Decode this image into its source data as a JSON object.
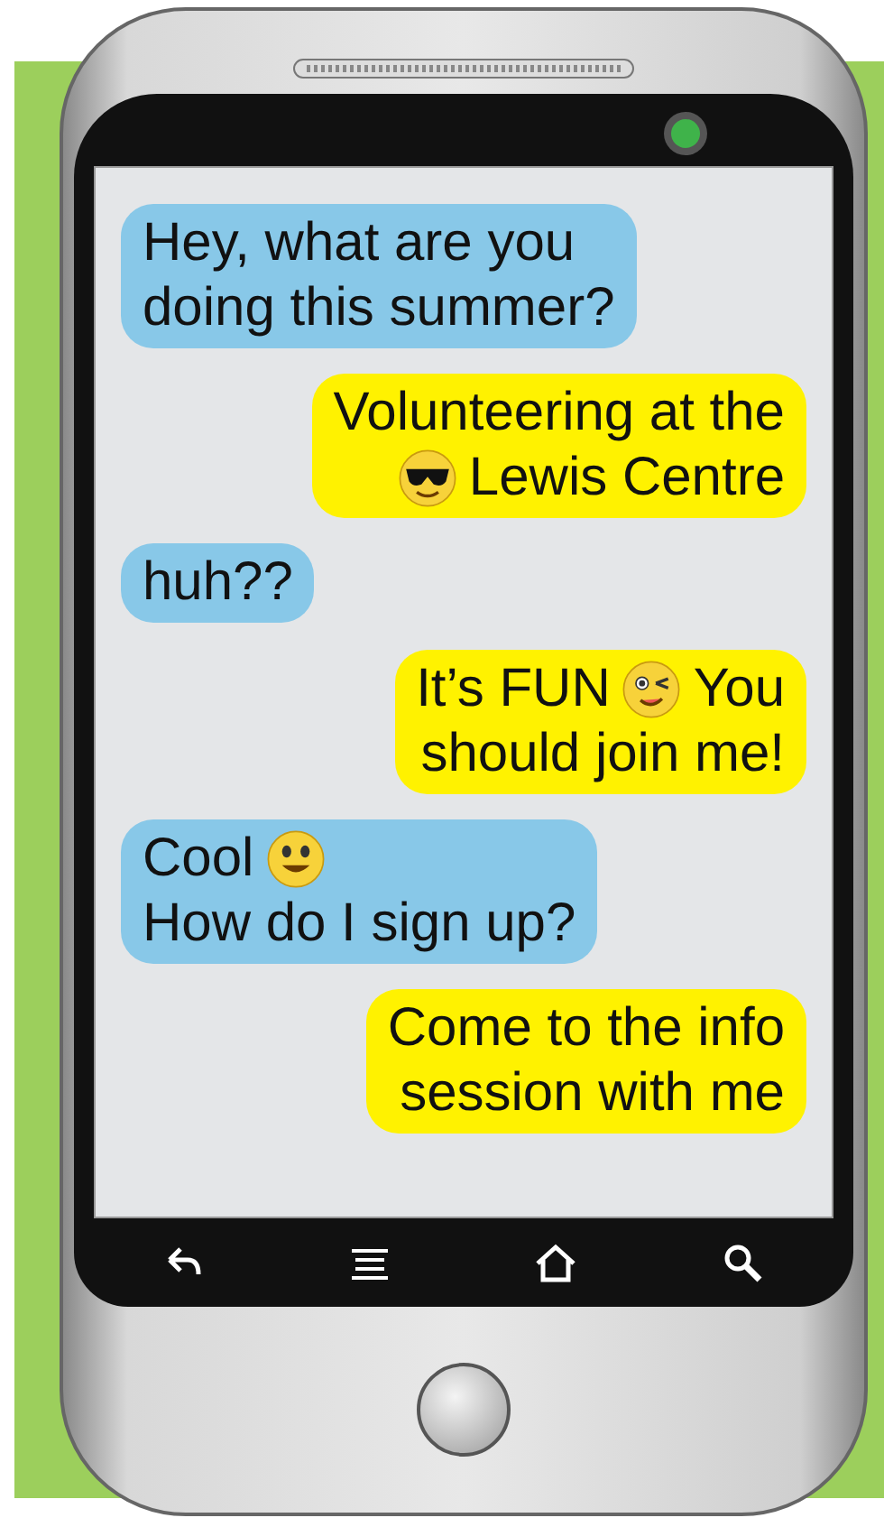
{
  "messages": [
    {
      "kind": "received",
      "lines": [
        [
          {
            "kind": "text",
            "text": "Hey, what are you"
          }
        ],
        [
          {
            "kind": "text",
            "text": "doing this summer?"
          }
        ]
      ]
    },
    {
      "kind": "sent",
      "lines": [
        [
          {
            "kind": "text",
            "text": "Volunteering at the"
          }
        ],
        [
          {
            "kind": "sunglasses"
          },
          {
            "kind": "text",
            "text": "Lewis Centre"
          }
        ]
      ]
    },
    {
      "kind": "received",
      "lines": [
        [
          {
            "kind": "text",
            "text": "huh??"
          }
        ]
      ]
    },
    {
      "kind": "sent",
      "lines": [
        [
          {
            "kind": "text",
            "text": "It’s FUN"
          },
          {
            "kind": "wink"
          },
          {
            "kind": "text",
            "text": "You"
          }
        ],
        [
          {
            "kind": "text",
            "text": "should join me!"
          }
        ]
      ]
    },
    {
      "kind": "received",
      "lines": [
        [
          {
            "kind": "text",
            "text": "Cool"
          },
          {
            "kind": "smile"
          }
        ],
        [
          {
            "kind": "text",
            "text": "How do I sign up?"
          }
        ]
      ]
    },
    {
      "kind": "sent",
      "lines": [
        [
          {
            "kind": "text",
            "text": "Come to the info"
          }
        ],
        [
          {
            "kind": "text",
            "text": "session with me"
          }
        ]
      ]
    }
  ]
}
